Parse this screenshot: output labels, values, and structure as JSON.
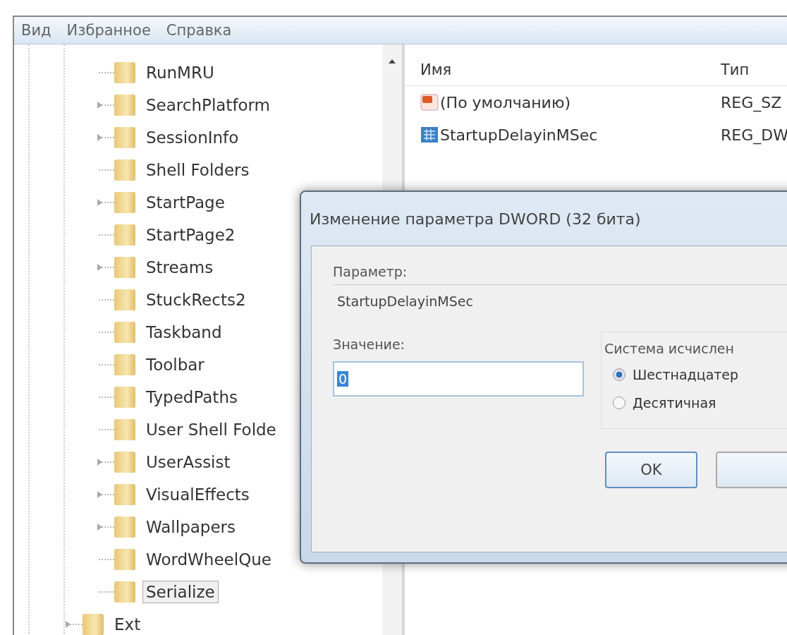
{
  "menu": [
    {
      "label": "Вид"
    },
    {
      "label": "Избранное"
    },
    {
      "label": "Справка"
    }
  ],
  "tree": {
    "nodes": [
      {
        "label": "RunMRU",
        "expandable": false,
        "selected": false
      },
      {
        "label": "SearchPlatform",
        "expandable": true,
        "selected": false
      },
      {
        "label": "SessionInfo",
        "expandable": true,
        "selected": false
      },
      {
        "label": "Shell Folders",
        "expandable": false,
        "selected": false
      },
      {
        "label": "StartPage",
        "expandable": true,
        "selected": false
      },
      {
        "label": "StartPage2",
        "expandable": false,
        "selected": false
      },
      {
        "label": "Streams",
        "expandable": true,
        "selected": false
      },
      {
        "label": "StuckRects2",
        "expandable": false,
        "selected": false
      },
      {
        "label": "Taskband",
        "expandable": false,
        "selected": false
      },
      {
        "label": "Toolbar",
        "expandable": false,
        "selected": false
      },
      {
        "label": "TypedPaths",
        "expandable": false,
        "selected": false
      },
      {
        "label": "User Shell Folde",
        "expandable": false,
        "selected": false
      },
      {
        "label": "UserAssist",
        "expandable": true,
        "selected": false
      },
      {
        "label": "VisualEffects",
        "expandable": true,
        "selected": false
      },
      {
        "label": "Wallpapers",
        "expandable": true,
        "selected": false
      },
      {
        "label": "WordWheelQue",
        "expandable": false,
        "selected": false
      },
      {
        "label": "Serialize",
        "expandable": false,
        "selected": true
      }
    ],
    "outer_nodes": [
      {
        "label": "Ext",
        "expandable": true,
        "selected": false
      }
    ]
  },
  "values": {
    "columns": [
      "Имя",
      "Тип"
    ],
    "rows": [
      {
        "kind": "string",
        "name": "(По умолчанию)",
        "type": "REG_SZ"
      },
      {
        "kind": "dword",
        "name": "StartupDelayinMSec",
        "type": "REG_DW"
      }
    ]
  },
  "dialog": {
    "title": "Изменение параметра DWORD (32 бита)",
    "name_label": "Параметр:",
    "name_value": "StartupDelayinMSec",
    "value_label": "Значение:",
    "value": "0",
    "base_group": "Система исчислен",
    "bases": [
      {
        "label": "Шестнадцатер",
        "selected": true
      },
      {
        "label": "Десятичная",
        "selected": false
      }
    ],
    "ok": "OK"
  }
}
